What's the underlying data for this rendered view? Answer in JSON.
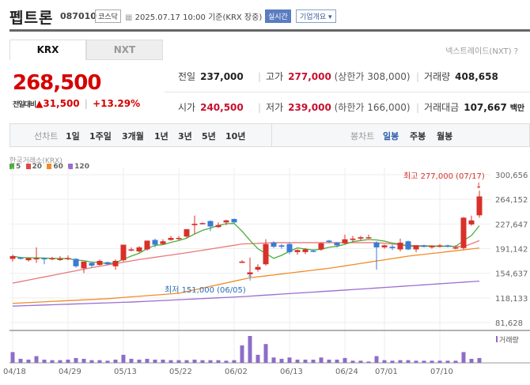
{
  "header": {
    "name": "펩트론",
    "code": "087010",
    "market": "코스닥",
    "datetime": "2025.07.17 10:00",
    "basis": "기준(KRX 장중)",
    "realtime": "실시간",
    "company_info": "기업개요 ▾"
  },
  "tabs": [
    {
      "label": "KRX"
    },
    {
      "label": "NXT"
    }
  ],
  "nextrade": "넥스트레이드(NXT) ?",
  "quote": {
    "price": "268,500",
    "change_label": "전일대비",
    "change": "▲31,500",
    "change_pct": "+13.29%",
    "prev_label": "전일",
    "prev": "237,000",
    "high_label": "고가",
    "high": "277,000",
    "upper_limit": "(상한가 308,000)",
    "volume_label": "거래량",
    "volume": "408,658",
    "open_label": "시가",
    "open": "240,500",
    "low_label": "저가",
    "low": "239,000",
    "lower_limit": "(하한가 166,000)",
    "value_label": "거래대금",
    "value": "107,667",
    "value_unit": "백만"
  },
  "periods": {
    "line_label": "선차트",
    "line": [
      "1일",
      "1주일",
      "3개월",
      "1년",
      "3년",
      "5년",
      "10년"
    ],
    "candle_label": "봉차트",
    "candle": [
      "일봉",
      "주봉",
      "월봉"
    ],
    "selected": "일봉"
  },
  "chart_data": {
    "type": "candlestick",
    "source": "한국거래소(KRX)",
    "legend": [
      {
        "name": "5",
        "color": "#4caf3c"
      },
      {
        "name": "20",
        "color": "#e04848"
      },
      {
        "name": "60",
        "color": "#f08c28"
      },
      {
        "name": "120",
        "color": "#9b6dd0"
      }
    ],
    "yticks": [
      "300,656",
      "264,152",
      "227,647",
      "191,142",
      "154,637",
      "118,133",
      "81,628"
    ],
    "ylim": [
      81628,
      300656
    ],
    "xticks": [
      {
        "i": 0,
        "label": "04/18"
      },
      {
        "i": 7,
        "label": "04/29"
      },
      {
        "i": 14,
        "label": "05/13"
      },
      {
        "i": 21,
        "label": "05/22"
      },
      {
        "i": 28,
        "label": "06/02"
      },
      {
        "i": 35,
        "label": "06/13"
      },
      {
        "i": 42,
        "label": "06/24"
      },
      {
        "i": 47,
        "label": "07/01"
      },
      {
        "i": 54,
        "label": "07/10"
      }
    ],
    "ohlc_thousands": [
      [
        176,
        182,
        172,
        180
      ],
      [
        178,
        179,
        175,
        176
      ],
      [
        174,
        178,
        172,
        177
      ],
      [
        176,
        193,
        170,
        177
      ],
      [
        177,
        178,
        168,
        176
      ],
      [
        176,
        179,
        174,
        177
      ],
      [
        175,
        180,
        173,
        176
      ],
      [
        176,
        181,
        174,
        177
      ],
      [
        176,
        177,
        163,
        165
      ],
      [
        162,
        172,
        155,
        172
      ],
      [
        170,
        171,
        163,
        166
      ],
      [
        167,
        175,
        166,
        173
      ],
      [
        171,
        172,
        167,
        168
      ],
      [
        165,
        175,
        160,
        173
      ],
      [
        174,
        197,
        172,
        197
      ],
      [
        190,
        193,
        187,
        190
      ],
      [
        187,
        195,
        185,
        193
      ],
      [
        190,
        203,
        188,
        203
      ],
      [
        204,
        206,
        193,
        197
      ],
      [
        198,
        205,
        197,
        202
      ],
      [
        204,
        210,
        203,
        207
      ],
      [
        206,
        210,
        204,
        207
      ],
      [
        209,
        220,
        207,
        220
      ],
      [
        226,
        240,
        213,
        228
      ],
      [
        228,
        230,
        227,
        229
      ],
      [
        232,
        233,
        217,
        224
      ],
      [
        223,
        230,
        222,
        226
      ],
      [
        230,
        234,
        226,
        233
      ],
      [
        235,
        236,
        229,
        230
      ],
      [
        170,
        174,
        170,
        172
      ],
      [
        153,
        178,
        151,
        156
      ],
      [
        160,
        168,
        157,
        164
      ],
      [
        168,
        205,
        166,
        198
      ],
      [
        200,
        202,
        192,
        194
      ],
      [
        196,
        198,
        191,
        194
      ],
      [
        198,
        200,
        183,
        186
      ],
      [
        186,
        190,
        182,
        189
      ],
      [
        186,
        192,
        183,
        190
      ],
      [
        188,
        190,
        186,
        187
      ],
      [
        190,
        200,
        188,
        199
      ],
      [
        203,
        204,
        199,
        201
      ],
      [
        200,
        201,
        193,
        196
      ],
      [
        199,
        212,
        197,
        205
      ],
      [
        204,
        210,
        201,
        206
      ],
      [
        206,
        210,
        203,
        208
      ],
      [
        208,
        212,
        206,
        208
      ],
      [
        200,
        202,
        160,
        193
      ],
      [
        193,
        197,
        191,
        196
      ],
      [
        194,
        197,
        189,
        192
      ],
      [
        190,
        206,
        187,
        200
      ],
      [
        202,
        203,
        189,
        190
      ],
      [
        190,
        196,
        186,
        196
      ],
      [
        196,
        197,
        193,
        194
      ],
      [
        193,
        196,
        191,
        195
      ],
      [
        195,
        198,
        193,
        196
      ],
      [
        196,
        197,
        193,
        194
      ],
      [
        192,
        196,
        190,
        193
      ],
      [
        192,
        238,
        190,
        237
      ],
      [
        227,
        240,
        225,
        233
      ],
      [
        240.5,
        277,
        237,
        268.5
      ]
    ],
    "ma": {
      "20": [
        [
          0,
          140
        ],
        [
          10,
          163
        ],
        [
          16,
          175
        ],
        [
          22,
          185
        ],
        [
          29,
          198
        ],
        [
          33,
          200
        ],
        [
          46,
          200
        ],
        [
          50,
          196
        ],
        [
          57,
          194
        ],
        [
          59,
          203
        ]
      ],
      "60": [
        [
          0,
          110
        ],
        [
          12,
          117
        ],
        [
          21,
          125
        ],
        [
          30,
          148
        ],
        [
          40,
          162
        ],
        [
          50,
          180
        ],
        [
          59,
          192
        ]
      ],
      "120": [
        [
          0,
          106
        ],
        [
          15,
          112
        ],
        [
          29,
          120
        ],
        [
          45,
          132
        ],
        [
          59,
          143
        ]
      ]
    },
    "volume_relative": [
      40,
      15,
      12,
      25,
      12,
      10,
      10,
      12,
      18,
      15,
      10,
      10,
      8,
      12,
      30,
      15,
      12,
      15,
      12,
      12,
      10,
      10,
      10,
      12,
      10,
      10,
      10,
      8,
      10,
      65,
      100,
      30,
      70,
      20,
      15,
      20,
      12,
      12,
      12,
      20,
      12,
      12,
      18,
      8,
      8,
      5,
      25,
      10,
      8,
      10,
      10,
      8,
      8,
      8,
      8,
      8,
      8,
      40,
      15,
      18
    ],
    "volume_label": "거래량",
    "annotations": {
      "high": "최고 277,000 (07/17)",
      "low": "최저 151,000 (06/05)"
    }
  }
}
